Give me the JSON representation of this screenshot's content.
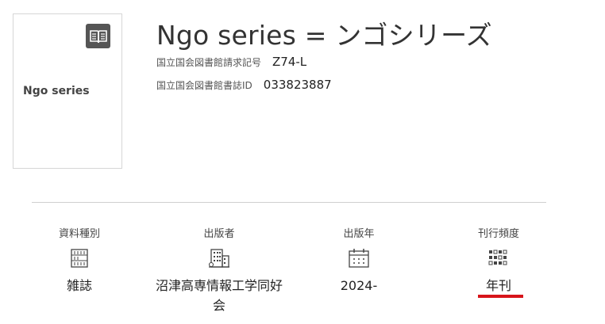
{
  "item": {
    "thumbnail_title": "Ngo series",
    "title": "Ngo series = ンゴシリーズ",
    "call_number_label": "国立国会図書館請求記号",
    "call_number": "Z74-L",
    "bib_id_label": "国立国会図書館書誌ID",
    "bib_id": "033823887"
  },
  "details": [
    {
      "label": "資料種別",
      "icon": "library-building-icon",
      "value": "雑誌"
    },
    {
      "label": "出版者",
      "icon": "office-building-icon",
      "value": "沼津高専情報工学同好会"
    },
    {
      "label": "出版年",
      "icon": "calendar-icon",
      "value": "2024-"
    },
    {
      "label": "刊行頻度",
      "icon": "frequency-grid-icon",
      "value": "年刊"
    }
  ],
  "colors": {
    "accent": "#d7141a",
    "badge": "#555555"
  }
}
